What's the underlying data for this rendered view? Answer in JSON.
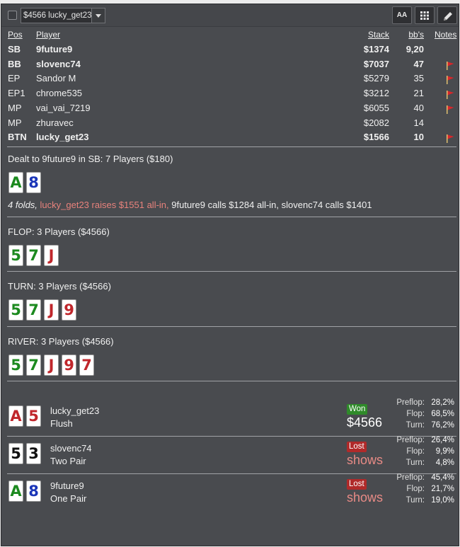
{
  "toolbar": {
    "hand_select": "$4566 lucky_get23",
    "font_button": "AA"
  },
  "players_header": {
    "pos": "Pos",
    "player": "Player",
    "stack": "Stack",
    "bbs": "bb's",
    "notes": "Notes"
  },
  "players": [
    {
      "pos": "SB",
      "name": "9future9",
      "stack": "$1374",
      "bbs": "9,20",
      "bold": true,
      "note_flag": false
    },
    {
      "pos": "BB",
      "name": "slovenc74",
      "stack": "$7037",
      "bbs": "47",
      "bold": true,
      "note_flag": true
    },
    {
      "pos": "EP",
      "name": "Sandor M",
      "stack": "$5279",
      "bbs": "35",
      "bold": false,
      "note_flag": true
    },
    {
      "pos": "EP1",
      "name": "chrome535",
      "stack": "$3212",
      "bbs": "21",
      "bold": false,
      "note_flag": true
    },
    {
      "pos": "MP",
      "name": "vai_vai_7219",
      "stack": "$6055",
      "bbs": "40",
      "bold": false,
      "note_flag": true
    },
    {
      "pos": "MP",
      "name": "zhuravec",
      "stack": "$2082",
      "bbs": "14",
      "bold": false,
      "note_flag": false
    },
    {
      "pos": "BTN",
      "name": "lucky_get23",
      "stack": "$1566",
      "bbs": "10",
      "bold": true,
      "note_flag": true
    }
  ],
  "preflop": {
    "title": "Dealt to 9future9 in SB: 7 Players ($180)",
    "cards": [
      {
        "rank": "A",
        "suit": "c"
      },
      {
        "rank": "8",
        "suit": "d"
      }
    ],
    "action_folds": "4 folds,",
    "action_raise": " lucky_get23 raises $1551 all-in,",
    "action_rest": " 9future9 calls $1284 all-in, slovenc74 calls $1401"
  },
  "flop": {
    "title": "FLOP: 3 Players ($4566)",
    "cards": [
      {
        "rank": "5",
        "suit": "c"
      },
      {
        "rank": "7",
        "suit": "c"
      },
      {
        "rank": "J",
        "suit": "h"
      }
    ]
  },
  "turn": {
    "title": "TURN: 3 Players ($4566)",
    "cards": [
      {
        "rank": "5",
        "suit": "c"
      },
      {
        "rank": "7",
        "suit": "c"
      },
      {
        "rank": "J",
        "suit": "h"
      },
      {
        "rank": "9",
        "suit": "h"
      }
    ]
  },
  "river": {
    "title": "RIVER: 3 Players ($4566)",
    "cards": [
      {
        "rank": "5",
        "suit": "c"
      },
      {
        "rank": "7",
        "suit": "c"
      },
      {
        "rank": "J",
        "suit": "h"
      },
      {
        "rank": "9",
        "suit": "h"
      },
      {
        "rank": "7",
        "suit": "h"
      }
    ]
  },
  "equity_labels": {
    "preflop": "Preflop:",
    "flop": "Flop:",
    "turn": "Turn:"
  },
  "results": [
    {
      "cards": [
        {
          "rank": "A",
          "suit": "h"
        },
        {
          "rank": "5",
          "suit": "h"
        }
      ],
      "name": "lucky_get23",
      "hand": "Flush",
      "status": "Won",
      "status_type": "won",
      "amount": "$4566",
      "preflop": "28,2%",
      "flop": "68,5%",
      "turn": "76,2%"
    },
    {
      "cards": [
        {
          "rank": "5",
          "suit": "s"
        },
        {
          "rank": "3",
          "suit": "s"
        }
      ],
      "name": "slovenc74",
      "hand": "Two Pair",
      "status": "Lost",
      "status_type": "lost",
      "amount": "shows",
      "preflop": "26,4%",
      "flop": "9,9%",
      "turn": "4,8%"
    },
    {
      "cards": [
        {
          "rank": "A",
          "suit": "c"
        },
        {
          "rank": "8",
          "suit": "d"
        }
      ],
      "name": "9future9",
      "hand": "One Pair",
      "status": "Lost",
      "status_type": "lost",
      "amount": "shows",
      "preflop": "45,4%",
      "flop": "21,7%",
      "turn": "19,0%"
    }
  ],
  "colors": {
    "background": "#494b4f",
    "spade": "#111111",
    "heart": "#c0262b",
    "diamond": "#1b36b8",
    "club": "#1c8a1f",
    "won_badge": "#2f8a2a",
    "lost_badge": "#b02a2a",
    "raise_text": "#e8827c",
    "note_flag": "#d8262a"
  }
}
